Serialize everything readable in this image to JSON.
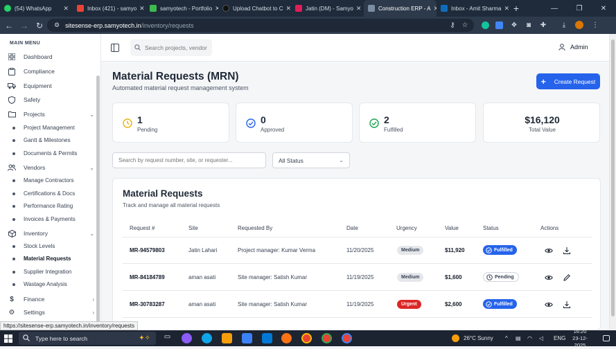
{
  "browser": {
    "tabs": [
      {
        "label": "(54) WhatsApp",
        "color": "#25d366"
      },
      {
        "label": "Inbox (421) - samyo",
        "color": "#ea4335"
      },
      {
        "label": "samyotech - Portfolio",
        "color": "#3dba4e"
      },
      {
        "label": "Upload Chatbot to C",
        "color": "#111111"
      },
      {
        "label": "Jatin (DM) - Samyo",
        "color": "#e01e5a"
      },
      {
        "label": "Construction ERP - A",
        "color": "#7c8ea3"
      },
      {
        "label": "Inbox - Amit Sharma",
        "color": "#0f6cbd"
      }
    ],
    "url_host": "sitesense-erp.samyotech.in",
    "url_path": "/inventory/requests",
    "status_url": "https://sitesense-erp.samyotech.in/inventory/requests"
  },
  "sidebar": {
    "menu_title": "MAIN MENU",
    "items": [
      {
        "label": "Dashboard",
        "icon": "grid-icon"
      },
      {
        "label": "Compliance",
        "icon": "clipboard-icon"
      },
      {
        "label": "Equipment",
        "icon": "truck-icon"
      },
      {
        "label": "Safety",
        "icon": "shield-icon"
      },
      {
        "label": "Projects",
        "icon": "folder-icon"
      },
      {
        "label": "Vendors",
        "icon": "users-icon"
      },
      {
        "label": "Inventory",
        "icon": "box-icon"
      },
      {
        "label": "Finance",
        "icon": "dollar-icon"
      },
      {
        "label": "Settings",
        "icon": "gear-icon"
      }
    ],
    "projects_sub": [
      "Project Management",
      "Gantt & Milestones",
      "Documents & Permits"
    ],
    "vendors_sub": [
      "Manage Contractors",
      "Certifications & Docs",
      "Performance Rating",
      "Invoices & Payments"
    ],
    "inventory_sub": [
      "Stock Levels",
      "Material Requests",
      "Supplier Integration",
      "Wastage Analysis"
    ]
  },
  "topbar": {
    "search_placeholder": "Search projects, vendors,",
    "user": "Admin"
  },
  "page": {
    "title": "Material Requests (MRN)",
    "subtitle": "Automated material request management system",
    "create_button": "Create Request"
  },
  "stats": [
    {
      "value": "1",
      "label": "Pending",
      "color": "#eab308"
    },
    {
      "value": "0",
      "label": "Approved",
      "color": "#2563eb"
    },
    {
      "value": "2",
      "label": "Fulfilled",
      "color": "#16a34a"
    },
    {
      "value": "$16,120",
      "label": "Total Value"
    }
  ],
  "filters": {
    "search_placeholder": "Search by request number, site, or requester...",
    "status_value": "All Status"
  },
  "table": {
    "title": "Material Requests",
    "subtitle": "Track and manage all material requests",
    "columns": [
      "Request #",
      "Site",
      "Requested By",
      "Date",
      "Urgency",
      "Value",
      "Status",
      "Actions"
    ],
    "rows": [
      {
        "id": "MR-94579803",
        "site": "Jatin Lahari",
        "requested_by": "Project manager: Kumar Verma",
        "date": "11/20/2025",
        "urgency": "Medium",
        "value": "$11,920",
        "status": "Fulfilled"
      },
      {
        "id": "MR-84184789",
        "site": "aman asati",
        "requested_by": "Site manager: Satish Kumar",
        "date": "11/19/2025",
        "urgency": "Medium",
        "value": "$1,600",
        "status": "Pending"
      },
      {
        "id": "MR-30783287",
        "site": "aman asati",
        "requested_by": "Site manager: Satish Kumar",
        "date": "11/19/2025",
        "urgency": "Urgent",
        "value": "$2,600",
        "status": "Fulfilled"
      }
    ]
  },
  "taskbar": {
    "search_placeholder": "Type here to search",
    "weather": "26°C  Sunny",
    "lang": "ENG",
    "time": "16:20",
    "date": "23-12-2025"
  }
}
